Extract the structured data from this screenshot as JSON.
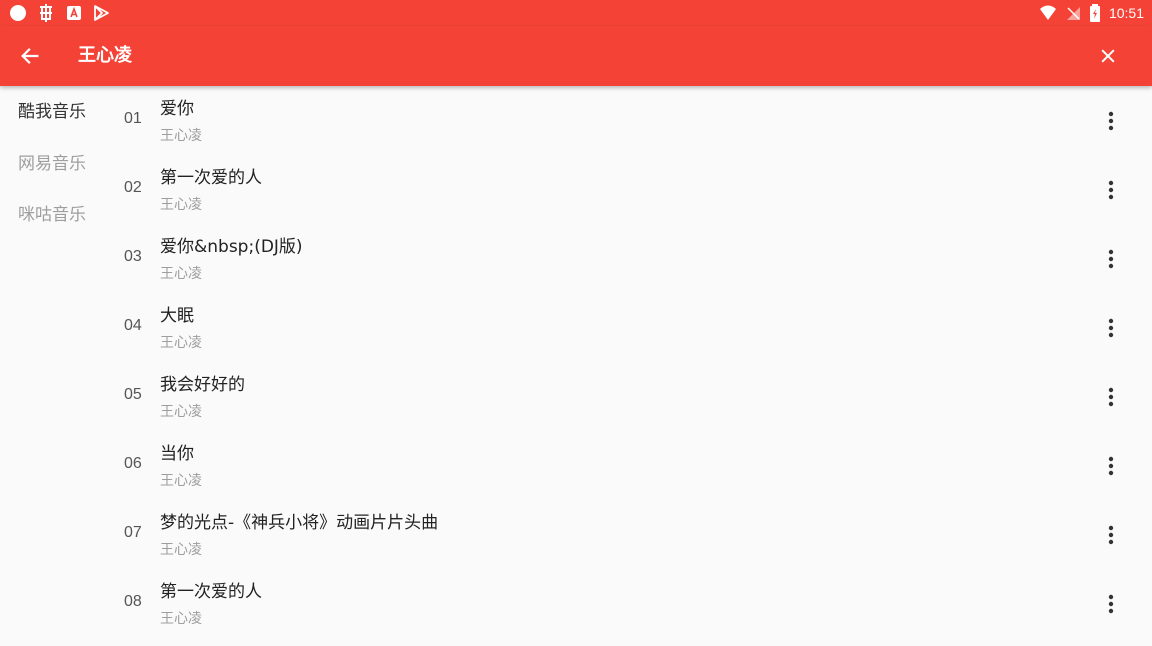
{
  "status_bar": {
    "time": "10:51"
  },
  "app_bar": {
    "title": "王心凌",
    "back_icon": "arrow-left-icon",
    "close_icon": "close-icon"
  },
  "sources": [
    {
      "label": "酷我音乐",
      "active": true
    },
    {
      "label": "网易音乐",
      "active": false
    },
    {
      "label": "咪咕音乐",
      "active": false
    }
  ],
  "songs": [
    {
      "no": "01",
      "title": "爱你",
      "artist": "王心凌"
    },
    {
      "no": "02",
      "title": "第一次爱的人",
      "artist": "王心凌"
    },
    {
      "no": "03",
      "title": "爱你&nbsp;(DJ版)",
      "artist": "王心凌"
    },
    {
      "no": "04",
      "title": "大眠",
      "artist": "王心凌"
    },
    {
      "no": "05",
      "title": "我会好好的",
      "artist": "王心凌"
    },
    {
      "no": "06",
      "title": "当你",
      "artist": "王心凌"
    },
    {
      "no": "07",
      "title": "梦的光点-《神兵小将》动画片片头曲",
      "artist": "王心凌"
    },
    {
      "no": "08",
      "title": "第一次爱的人",
      "artist": "王心凌"
    }
  ],
  "colors": {
    "primary": "#f44336",
    "inactive_text": "#9e9e9e"
  }
}
